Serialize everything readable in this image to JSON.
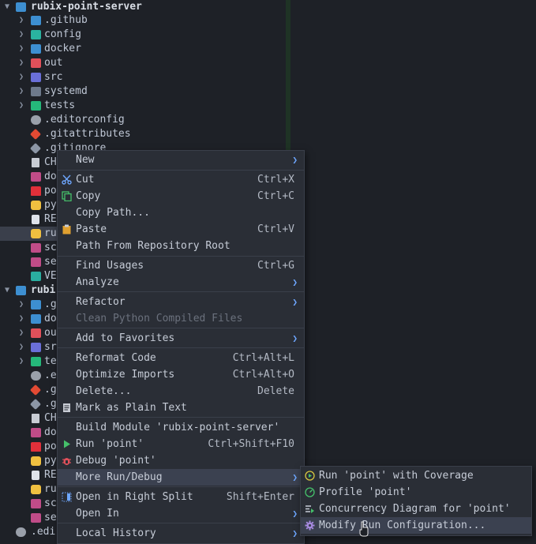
{
  "tree": {
    "root1": "rubix-point-server",
    "items1": [
      ".github",
      "config",
      "docker",
      "out",
      "src",
      "systemd",
      "tests",
      ".editorconfig",
      ".gitattributes",
      ".gitignore",
      "CH",
      "do",
      "po",
      "py",
      "RE",
      "ru",
      "sc",
      "se",
      "VE"
    ],
    "root2": "rubi",
    "items2": [
      ".g",
      "do",
      "ou",
      "sr",
      "te",
      ".e",
      ".g",
      ".g",
      "CH",
      "do",
      "po",
      "py",
      "RE",
      "ru",
      "sc",
      "se"
    ],
    "bottom_item": ".edi"
  },
  "menu": {
    "items": [
      {
        "label": "New",
        "shortcut": "",
        "submenu": true
      },
      {
        "label": "Cut",
        "shortcut": "Ctrl+X",
        "icon": "scissors-icon"
      },
      {
        "label": "Copy",
        "shortcut": "Ctrl+C",
        "icon": "copy-icon"
      },
      {
        "label": "Copy Path...",
        "shortcut": ""
      },
      {
        "label": "Paste",
        "shortcut": "Ctrl+V",
        "icon": "clipboard-icon"
      },
      {
        "label": "Path From Repository Root",
        "shortcut": ""
      },
      {
        "label": "Find Usages",
        "shortcut": "Ctrl+G"
      },
      {
        "label": "Analyze",
        "shortcut": "",
        "submenu": true
      },
      {
        "label": "Refactor",
        "shortcut": "",
        "submenu": true
      },
      {
        "label": "Clean Python Compiled Files",
        "shortcut": "",
        "disabled": true
      },
      {
        "label": "Add to Favorites",
        "shortcut": "",
        "submenu": true
      },
      {
        "label": "Reformat Code",
        "shortcut": "Ctrl+Alt+L"
      },
      {
        "label": "Optimize Imports",
        "shortcut": "Ctrl+Alt+O"
      },
      {
        "label": "Delete...",
        "shortcut": "Delete"
      },
      {
        "label": "Mark as Plain Text",
        "shortcut": "",
        "icon": "plain-text-icon"
      },
      {
        "label": "Build Module 'rubix-point-server'",
        "shortcut": ""
      },
      {
        "label": "Run 'point'",
        "shortcut": "Ctrl+Shift+F10",
        "icon": "run-icon"
      },
      {
        "label": "Debug 'point'",
        "shortcut": "",
        "icon": "debug-icon"
      },
      {
        "label": "More Run/Debug",
        "shortcut": "",
        "submenu": true
      },
      {
        "label": "Open in Right Split",
        "shortcut": "Shift+Enter",
        "icon": "split-icon"
      },
      {
        "label": "Open In",
        "shortcut": "",
        "submenu": true
      },
      {
        "label": "Local History",
        "shortcut": "",
        "submenu": true
      }
    ]
  },
  "submenu": {
    "items": [
      {
        "label": "Run 'point' with Coverage",
        "icon": "coverage-icon"
      },
      {
        "label": "Profile 'point'",
        "icon": "profile-icon"
      },
      {
        "label": "Concurrency Diagram for 'point'",
        "icon": "concurrency-icon"
      },
      {
        "label": "Modify Run Configuration...",
        "icon": "gear-icon"
      }
    ]
  },
  "colors": {
    "accent": "#6ea7ff",
    "highlight": "#3b4150",
    "menu_bg": "#2a2e36"
  }
}
